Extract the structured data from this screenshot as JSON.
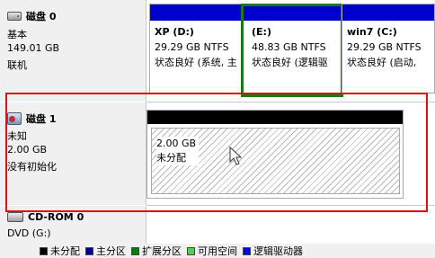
{
  "disk0": {
    "title": "磁盘 0",
    "type": "基本",
    "size": "149.01 GB",
    "status": "联机",
    "icon": "drive-icon",
    "partitions": [
      {
        "name": "XP  (D:)",
        "size": "29.29 GB NTFS",
        "status": "状态良好 (系统, 主",
        "bar_color": "#0000cc"
      },
      {
        "name": "(E:)",
        "size": "48.83 GB NTFS",
        "status": "状态良好 (逻辑驱",
        "bar_color": "#0000cc"
      },
      {
        "name": "win7  (C:)",
        "size": "29.29 GB NTFS",
        "status": "状态良好 (启动,",
        "bar_color": "#0000cc"
      }
    ]
  },
  "disk1": {
    "title": "磁盘 1",
    "type": "未知",
    "size": "2.00 GB",
    "status": "没有初始化",
    "icon": "disk-icon",
    "unallocated": {
      "size": "2.00 GB",
      "label": "未分配",
      "bar_color": "#000000"
    }
  },
  "cdrom": {
    "title": "CD-ROM 0",
    "type": "DVD (G:)",
    "icon": "cd-icon"
  },
  "legend": [
    {
      "label": "未分配",
      "color": "#000000"
    },
    {
      "label": "主分区",
      "color": "#000080"
    },
    {
      "label": "扩展分区",
      "color": "#008000"
    },
    {
      "label": "可用空间",
      "color": "#55cc55"
    },
    {
      "label": "逻辑驱动器",
      "color": "#0000ff"
    }
  ],
  "colors": {
    "highlight_box": "#dd1111",
    "selection_outline": "#1a7a1a"
  }
}
